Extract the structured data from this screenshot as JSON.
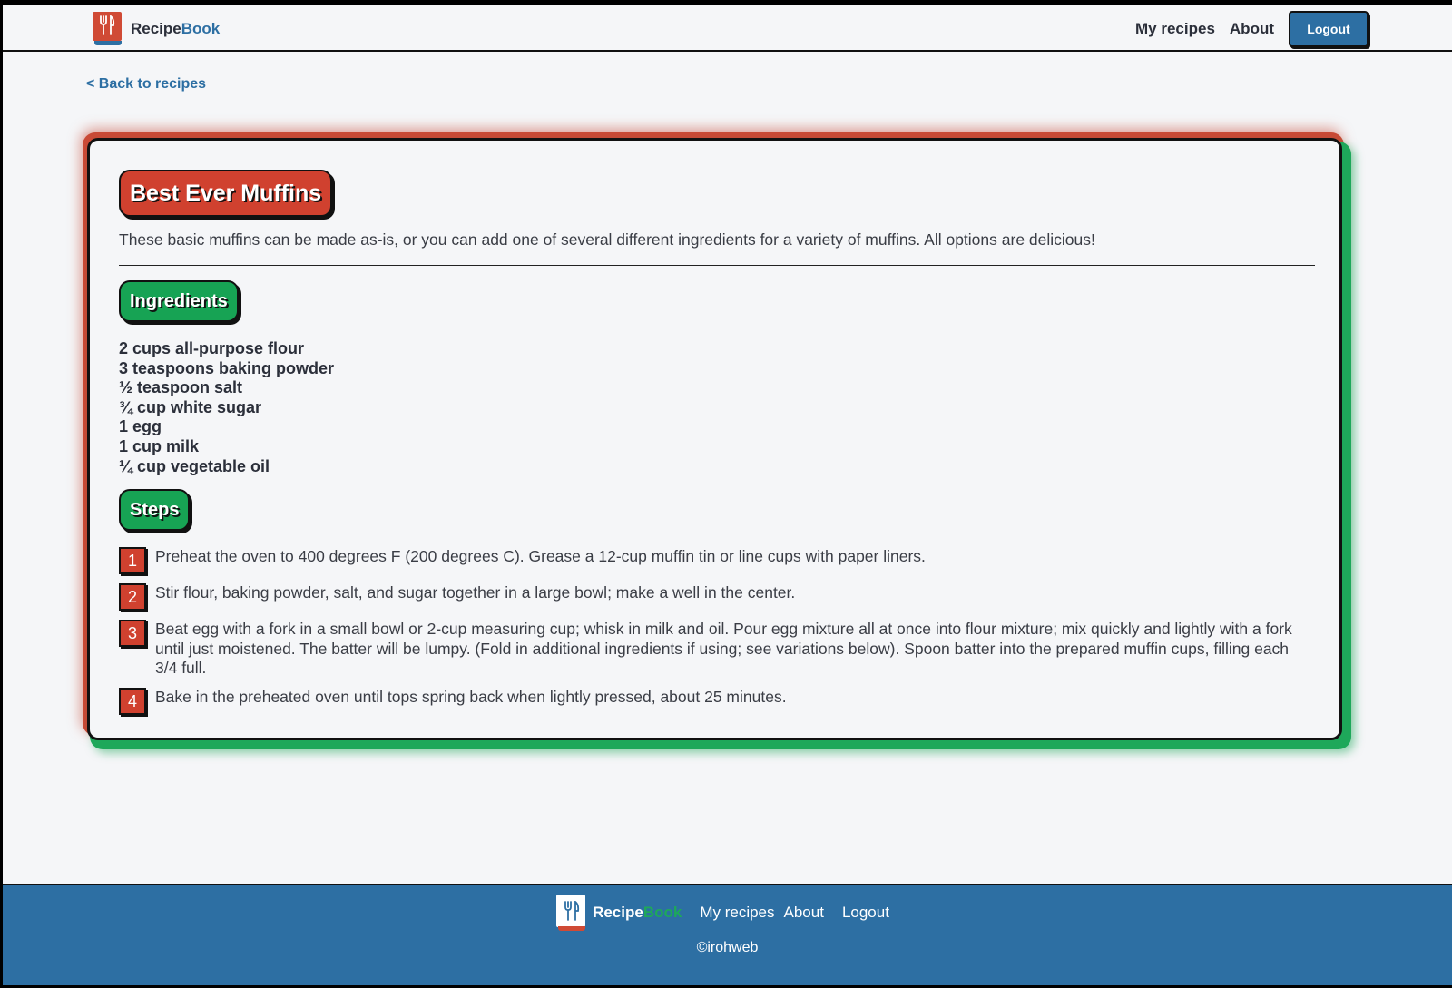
{
  "header": {
    "logo": {
      "part1": "Recipe",
      "part2": "Book"
    },
    "nav": {
      "my_recipes": "My recipes",
      "about": "About",
      "logout": "Logout"
    }
  },
  "back_link": "< Back to recipes",
  "recipe": {
    "title": "Best Ever Muffins",
    "description": "These basic muffins can be made as-is, or you can add one of several different ingredients for a variety of muffins. All options are delicious!",
    "ingredients_heading": "Ingredients",
    "ingredients": [
      "2 cups all-purpose flour",
      "3 teaspoons baking powder",
      "½ teaspoon salt",
      "¾ cup white sugar",
      "1 egg",
      "1 cup milk",
      "¼ cup vegetable oil"
    ],
    "steps_heading": "Steps",
    "steps": [
      {
        "num": "1",
        "text": "Preheat the oven to 400 degrees F (200 degrees C). Grease a 12-cup muffin tin or line cups with paper liners."
      },
      {
        "num": "2",
        "text": "Stir flour, baking powder, salt, and sugar together in a large bowl; make a well in the center."
      },
      {
        "num": "3",
        "text": "Beat egg with a fork in a small bowl or 2-cup measuring cup; whisk in milk and oil. Pour egg mixture all at once into flour mixture; mix quickly and lightly with a fork until just moistened. The batter will be lumpy. (Fold in additional ingredients if using; see variations below). Spoon batter into the prepared muffin cups, filling each 3/4 full."
      },
      {
        "num": "4",
        "text": "Bake in the preheated oven until tops spring back when lightly pressed, about 25 minutes."
      }
    ]
  },
  "footer": {
    "logo": {
      "part1": "Recipe",
      "part2": "Book"
    },
    "nav": {
      "my_recipes": "My recipes",
      "about": "About",
      "logout": "Logout"
    },
    "copyright": "©irohweb"
  },
  "colors": {
    "primary_blue": "#2d6fa3",
    "accent_red": "#d0412f",
    "accent_green": "#17a354"
  }
}
